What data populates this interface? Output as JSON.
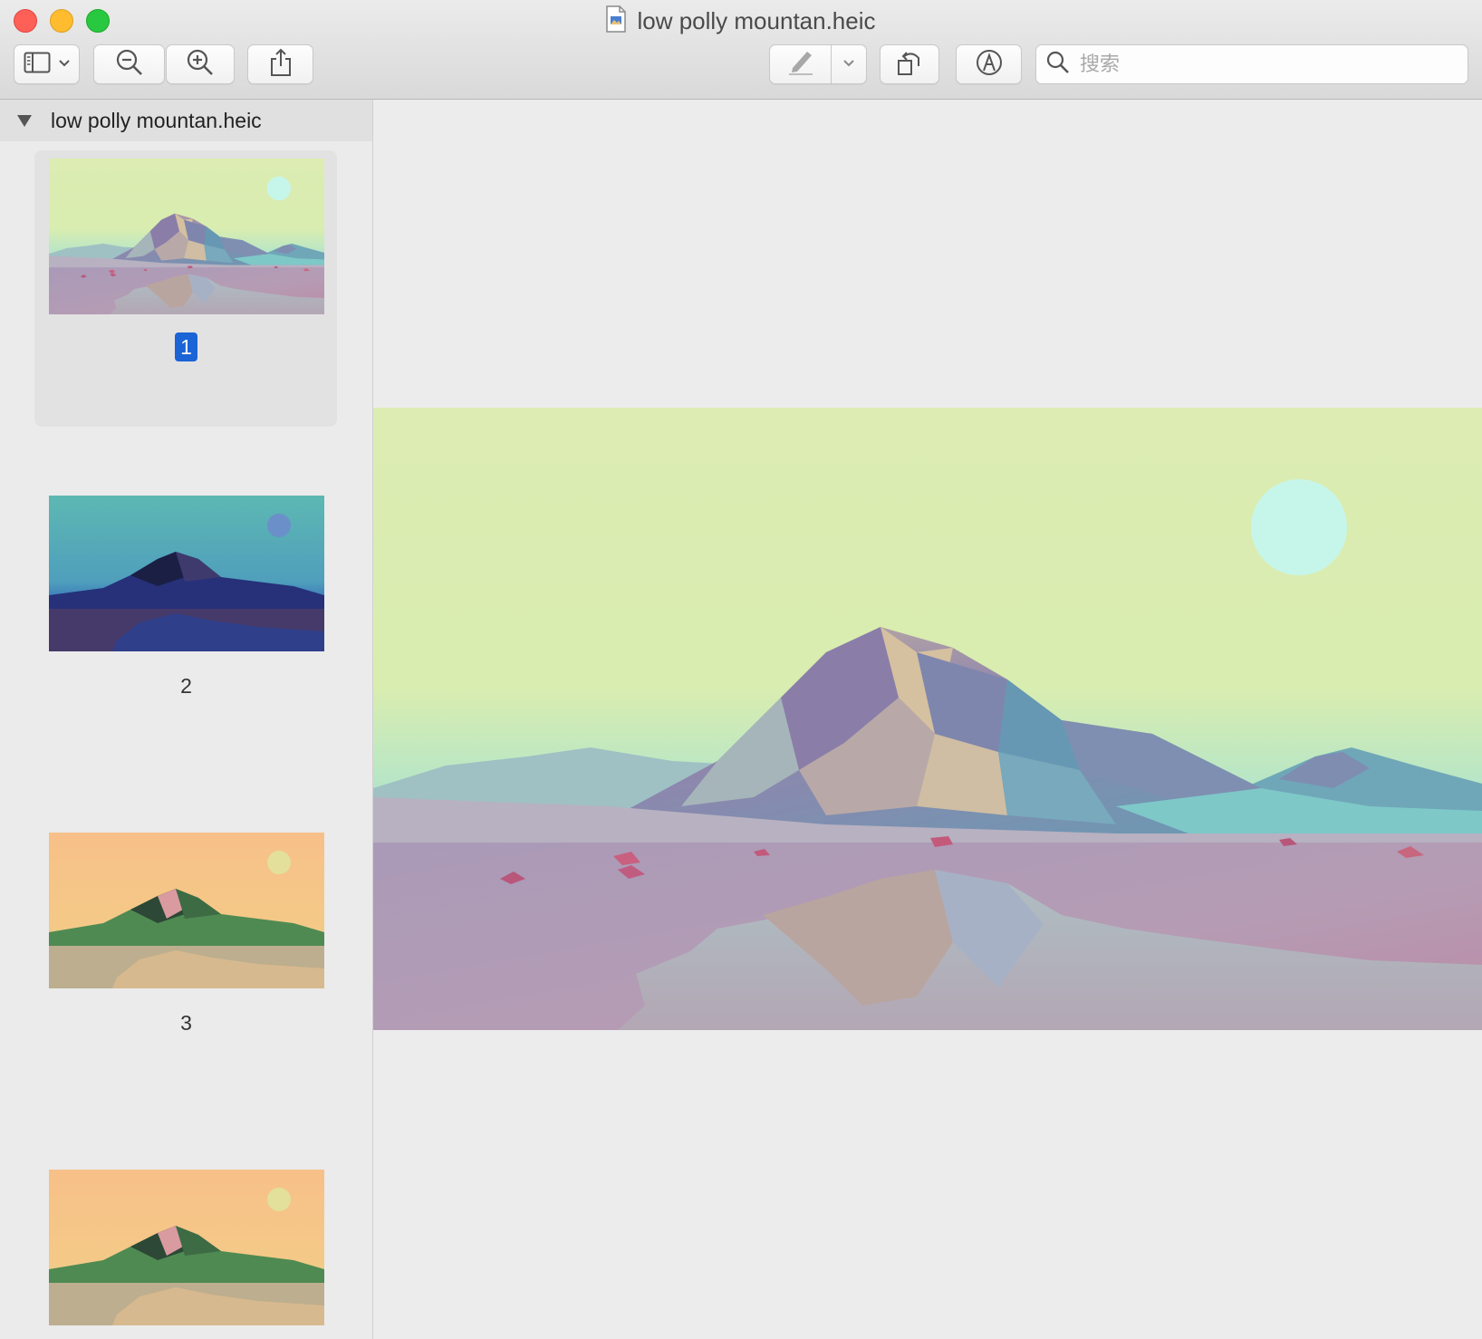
{
  "window": {
    "title": "low polly mountan.heic"
  },
  "toolbar": {
    "sidebar_toggle": "sidebar-icon",
    "zoom_out": "zoom-out-icon",
    "zoom_in": "zoom-in-icon",
    "share": "share-icon",
    "markup": "pen-icon",
    "rotate": "rotate-icon",
    "annotate": "markup-icon"
  },
  "search": {
    "placeholder": "搜索"
  },
  "sidebar": {
    "document_name": "low polly mountan.heic",
    "pages": [
      {
        "label": "1",
        "selected": true
      },
      {
        "label": "2",
        "selected": false
      },
      {
        "label": "3",
        "selected": false
      },
      {
        "label": "",
        "selected": false
      }
    ]
  },
  "colors": {
    "selection": "#1b64d6",
    "close": "#fe5f57",
    "minimize": "#febc2e",
    "maximize": "#28c840"
  }
}
